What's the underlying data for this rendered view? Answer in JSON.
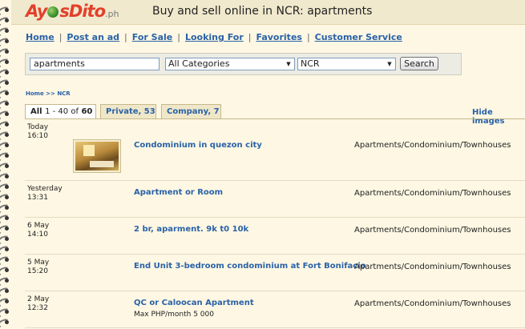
{
  "header": {
    "logo_main": "Ay",
    "logo_rest": "sDito",
    "logo_suffix": ".ph",
    "tagline": "Buy and sell online in NCR: apartments"
  },
  "nav": [
    "Home",
    "Post an ad",
    "For Sale",
    "Looking For",
    "Favorites",
    "Customer Service"
  ],
  "search": {
    "query": "apartments",
    "category": "All Categories",
    "region": "NCR",
    "button": "Search"
  },
  "breadcrumb": "Home >> NCR",
  "tabs": {
    "all_label": "All",
    "all_range": "1 - 40 of",
    "all_total": "60",
    "private": "Private, 53",
    "company": "Company, 7"
  },
  "hide_images": "Hide images",
  "listings": [
    {
      "day": "Today",
      "time": "16:10",
      "title": "Condominium in quezon city",
      "category": "Apartments/Condominium/Townhouses",
      "price": ""
    },
    {
      "day": "Yesterday",
      "time": "13:31",
      "title": "Apartment or Room",
      "category": "Apartments/Condominium/Townhouses",
      "price": ""
    },
    {
      "day": "6 May",
      "time": "14:10",
      "title": "2 br, aparment. 9k t0 10k",
      "category": "Apartments/Condominium/Townhouses",
      "price": ""
    },
    {
      "day": "5 May",
      "time": "15:20",
      "title": "End Unit 3-bedroom condominium at Fort Bonifacio",
      "category": "Apartments/Condominium/Townhouses",
      "price": ""
    },
    {
      "day": "2 May",
      "time": "12:32",
      "title": "QC or Caloocan Apartment",
      "category": "Apartments/Condominium/Townhouses",
      "price": "Max PHP/month 5 000"
    }
  ]
}
